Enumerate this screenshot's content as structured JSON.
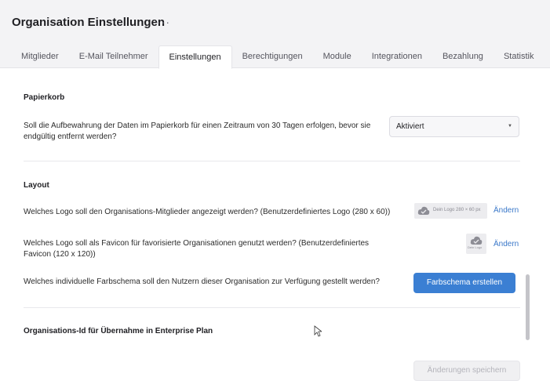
{
  "header": {
    "title": "Organisation Einstellungen",
    "more_label": "···"
  },
  "tabs": [
    {
      "label": "Mitglieder",
      "active": false
    },
    {
      "label": "E-Mail Teilnehmer",
      "active": false
    },
    {
      "label": "Einstellungen",
      "active": true
    },
    {
      "label": "Berechtigungen",
      "active": false
    },
    {
      "label": "Module",
      "active": false
    },
    {
      "label": "Integrationen",
      "active": false
    },
    {
      "label": "Bezahlung",
      "active": false
    },
    {
      "label": "Statistik",
      "active": false
    }
  ],
  "papierkorb": {
    "title": "Papierkorb",
    "question_line1": "Soll die Aufbewahrung der Daten im Papierkorb für einen Zeitraum von 30 Tagen erfolgen, bevor sie",
    "question_line2": "endgültig entfernt werden?",
    "select_value": "Aktiviert"
  },
  "layout": {
    "title": "Layout",
    "logo_question": "Welches Logo soll den Organisations-Mitglieder angezeigt werden? (Benutzerdefiniertes Logo (280 x 60))",
    "logo_placeholder": "Dein Logo 280 × 60 px",
    "logo_change": "Ändern",
    "favicon_question_line1": "Welches Logo soll als Favicon für favorisierte Organisationen genutzt werden? (Benutzerdefiniertes",
    "favicon_question_line2": "Favicon (120 x 120))",
    "favicon_placeholder": "Dein Logo",
    "favicon_change": "Ändern",
    "color_question": "Welches individuelle Farbschema soll den Nutzern dieser Organisation zur Verfügung gestellt werden?",
    "color_button": "Farbschema erstellen"
  },
  "enterprise": {
    "title": "Organisations-Id für Übernahme in Enterprise Plan"
  },
  "footer": {
    "save_button": "Änderungen speichern"
  },
  "colors": {
    "accent": "#3b7fd3",
    "link": "#3a78c9",
    "header_bg": "#f3f3f5"
  }
}
